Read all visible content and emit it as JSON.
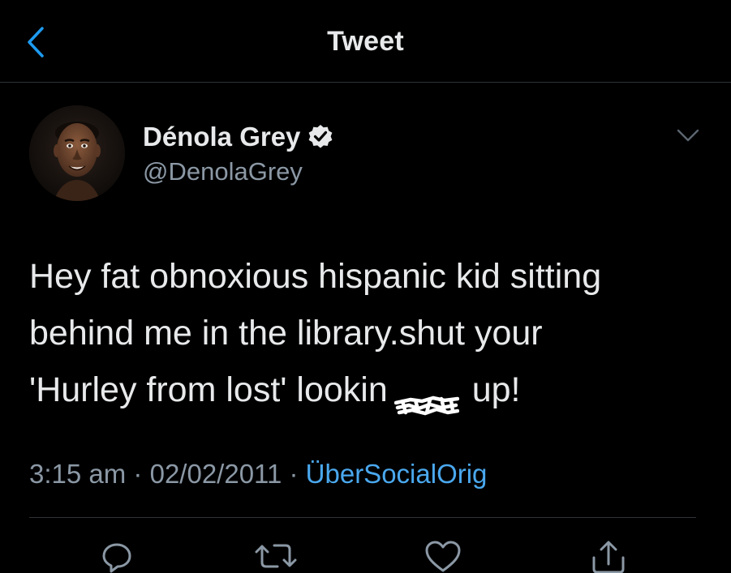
{
  "header": {
    "title": "Tweet",
    "back_icon": "chevron-left-icon"
  },
  "author": {
    "name": "Dénola Grey",
    "handle": "@DenolaGrey",
    "verified_icon": "verified-badge-icon"
  },
  "tweet": {
    "text_before": "Hey fat obnoxious hispanic kid sitting\nbehind me in the library.shut your\n'Hurley from lost' lookin",
    "text_after": " up!",
    "time": "3:15 am",
    "separator": "·",
    "date": "02/02/2011",
    "source": "ÜberSocialOrig"
  },
  "actions": {
    "reply_icon": "reply-icon",
    "retweet_icon": "retweet-icon",
    "like_icon": "heart-icon",
    "share_icon": "share-icon"
  },
  "colors": {
    "background": "#000000",
    "accent": "#1d9bf0",
    "text_primary": "#e7e9ea",
    "text_secondary": "#8b98a5"
  }
}
